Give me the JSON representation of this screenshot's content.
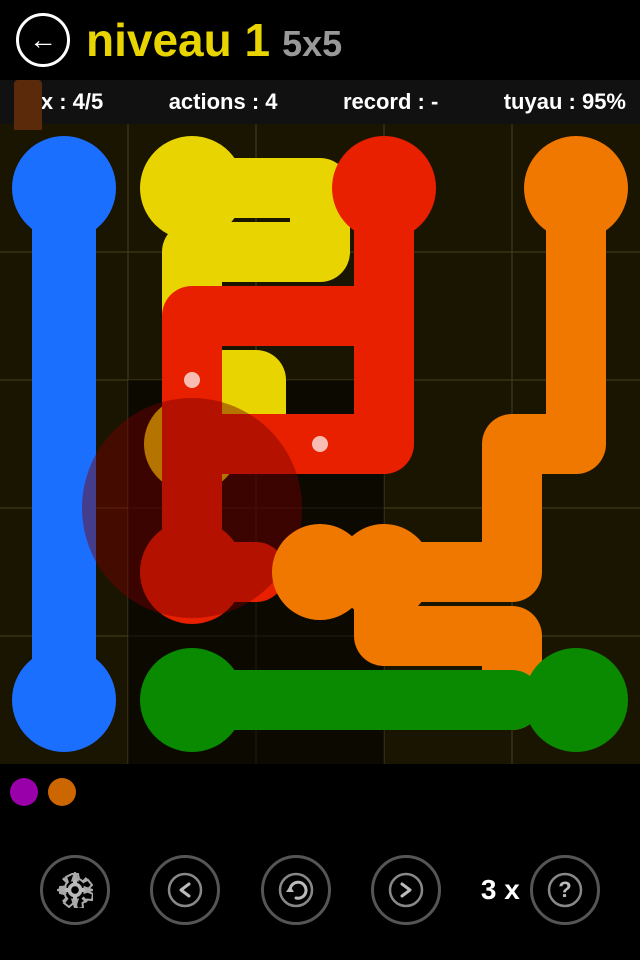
{
  "header": {
    "back_label": "←",
    "level_label": "niveau 1",
    "grid_label": "5x5"
  },
  "stats": {
    "flux_label": "flux : 4/5",
    "actions_label": "actions : 4",
    "record_label": "record : -",
    "tuyau_label": "tuyau : 95%"
  },
  "footer": {
    "back_label": "←",
    "hint_count": "3 x",
    "hint_question": "?"
  },
  "colors": {
    "blue": "#1a6fff",
    "yellow": "#e8d400",
    "red": "#e82000",
    "orange": "#f07800",
    "green": "#0a8a00",
    "dark_red": "#8a0000",
    "brown": "#5a2a0a"
  }
}
